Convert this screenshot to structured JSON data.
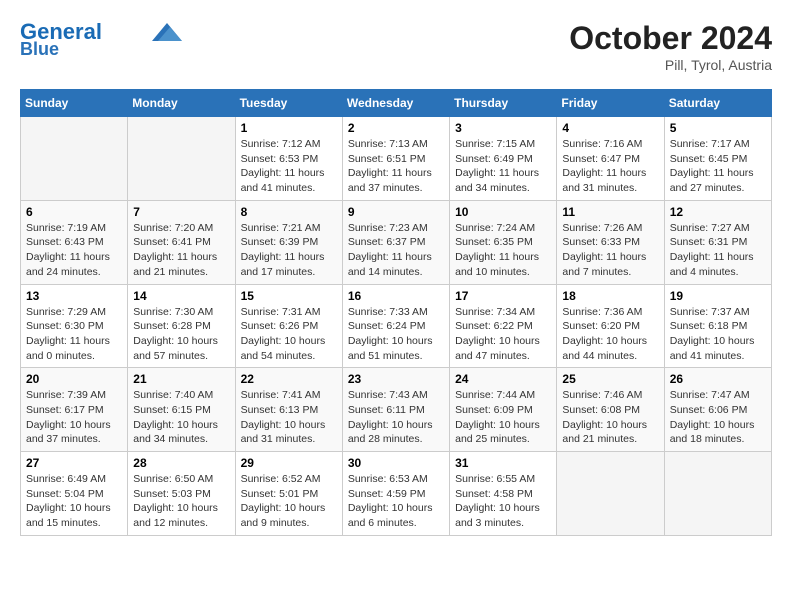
{
  "header": {
    "logo_line1": "General",
    "logo_line2": "Blue",
    "month": "October 2024",
    "location": "Pill, Tyrol, Austria"
  },
  "weekdays": [
    "Sunday",
    "Monday",
    "Tuesday",
    "Wednesday",
    "Thursday",
    "Friday",
    "Saturday"
  ],
  "weeks": [
    [
      {
        "day": "",
        "detail": ""
      },
      {
        "day": "",
        "detail": ""
      },
      {
        "day": "1",
        "detail": "Sunrise: 7:12 AM\nSunset: 6:53 PM\nDaylight: 11 hours and 41 minutes."
      },
      {
        "day": "2",
        "detail": "Sunrise: 7:13 AM\nSunset: 6:51 PM\nDaylight: 11 hours and 37 minutes."
      },
      {
        "day": "3",
        "detail": "Sunrise: 7:15 AM\nSunset: 6:49 PM\nDaylight: 11 hours and 34 minutes."
      },
      {
        "day": "4",
        "detail": "Sunrise: 7:16 AM\nSunset: 6:47 PM\nDaylight: 11 hours and 31 minutes."
      },
      {
        "day": "5",
        "detail": "Sunrise: 7:17 AM\nSunset: 6:45 PM\nDaylight: 11 hours and 27 minutes."
      }
    ],
    [
      {
        "day": "6",
        "detail": "Sunrise: 7:19 AM\nSunset: 6:43 PM\nDaylight: 11 hours and 24 minutes."
      },
      {
        "day": "7",
        "detail": "Sunrise: 7:20 AM\nSunset: 6:41 PM\nDaylight: 11 hours and 21 minutes."
      },
      {
        "day": "8",
        "detail": "Sunrise: 7:21 AM\nSunset: 6:39 PM\nDaylight: 11 hours and 17 minutes."
      },
      {
        "day": "9",
        "detail": "Sunrise: 7:23 AM\nSunset: 6:37 PM\nDaylight: 11 hours and 14 minutes."
      },
      {
        "day": "10",
        "detail": "Sunrise: 7:24 AM\nSunset: 6:35 PM\nDaylight: 11 hours and 10 minutes."
      },
      {
        "day": "11",
        "detail": "Sunrise: 7:26 AM\nSunset: 6:33 PM\nDaylight: 11 hours and 7 minutes."
      },
      {
        "day": "12",
        "detail": "Sunrise: 7:27 AM\nSunset: 6:31 PM\nDaylight: 11 hours and 4 minutes."
      }
    ],
    [
      {
        "day": "13",
        "detail": "Sunrise: 7:29 AM\nSunset: 6:30 PM\nDaylight: 11 hours and 0 minutes."
      },
      {
        "day": "14",
        "detail": "Sunrise: 7:30 AM\nSunset: 6:28 PM\nDaylight: 10 hours and 57 minutes."
      },
      {
        "day": "15",
        "detail": "Sunrise: 7:31 AM\nSunset: 6:26 PM\nDaylight: 10 hours and 54 minutes."
      },
      {
        "day": "16",
        "detail": "Sunrise: 7:33 AM\nSunset: 6:24 PM\nDaylight: 10 hours and 51 minutes."
      },
      {
        "day": "17",
        "detail": "Sunrise: 7:34 AM\nSunset: 6:22 PM\nDaylight: 10 hours and 47 minutes."
      },
      {
        "day": "18",
        "detail": "Sunrise: 7:36 AM\nSunset: 6:20 PM\nDaylight: 10 hours and 44 minutes."
      },
      {
        "day": "19",
        "detail": "Sunrise: 7:37 AM\nSunset: 6:18 PM\nDaylight: 10 hours and 41 minutes."
      }
    ],
    [
      {
        "day": "20",
        "detail": "Sunrise: 7:39 AM\nSunset: 6:17 PM\nDaylight: 10 hours and 37 minutes."
      },
      {
        "day": "21",
        "detail": "Sunrise: 7:40 AM\nSunset: 6:15 PM\nDaylight: 10 hours and 34 minutes."
      },
      {
        "day": "22",
        "detail": "Sunrise: 7:41 AM\nSunset: 6:13 PM\nDaylight: 10 hours and 31 minutes."
      },
      {
        "day": "23",
        "detail": "Sunrise: 7:43 AM\nSunset: 6:11 PM\nDaylight: 10 hours and 28 minutes."
      },
      {
        "day": "24",
        "detail": "Sunrise: 7:44 AM\nSunset: 6:09 PM\nDaylight: 10 hours and 25 minutes."
      },
      {
        "day": "25",
        "detail": "Sunrise: 7:46 AM\nSunset: 6:08 PM\nDaylight: 10 hours and 21 minutes."
      },
      {
        "day": "26",
        "detail": "Sunrise: 7:47 AM\nSunset: 6:06 PM\nDaylight: 10 hours and 18 minutes."
      }
    ],
    [
      {
        "day": "27",
        "detail": "Sunrise: 6:49 AM\nSunset: 5:04 PM\nDaylight: 10 hours and 15 minutes."
      },
      {
        "day": "28",
        "detail": "Sunrise: 6:50 AM\nSunset: 5:03 PM\nDaylight: 10 hours and 12 minutes."
      },
      {
        "day": "29",
        "detail": "Sunrise: 6:52 AM\nSunset: 5:01 PM\nDaylight: 10 hours and 9 minutes."
      },
      {
        "day": "30",
        "detail": "Sunrise: 6:53 AM\nSunset: 4:59 PM\nDaylight: 10 hours and 6 minutes."
      },
      {
        "day": "31",
        "detail": "Sunrise: 6:55 AM\nSunset: 4:58 PM\nDaylight: 10 hours and 3 minutes."
      },
      {
        "day": "",
        "detail": ""
      },
      {
        "day": "",
        "detail": ""
      }
    ]
  ]
}
